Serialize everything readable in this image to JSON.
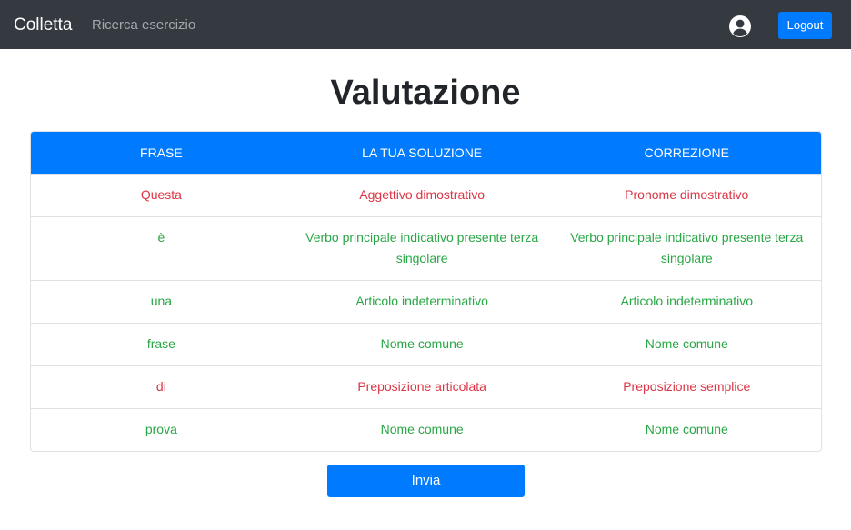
{
  "navbar": {
    "brand": "Colletta",
    "link": "Ricerca esercizio",
    "user_icon": "user-circle-icon",
    "logout_label": "Logout"
  },
  "page": {
    "title": "Valutazione"
  },
  "table": {
    "headers": [
      "FRASE",
      "LA TUA SOLUZIONE",
      "CORREZIONE"
    ],
    "rows": [
      {
        "word": "Questa",
        "solution": "Aggettivo dimostrativo",
        "correction": "Pronome dimostrativo",
        "status": "wrong"
      },
      {
        "word": "è",
        "solution": "Verbo principale indicativo presente terza singolare",
        "correction": "Verbo principale indicativo presente terza singolare",
        "status": "correct"
      },
      {
        "word": "una",
        "solution": "Articolo indeterminativo",
        "correction": "Articolo indeterminativo",
        "status": "correct"
      },
      {
        "word": "frase",
        "solution": "Nome comune",
        "correction": "Nome comune",
        "status": "correct"
      },
      {
        "word": "di",
        "solution": "Preposizione articolata",
        "correction": "Preposizione semplice",
        "status": "wrong"
      },
      {
        "word": "prova",
        "solution": "Nome comune",
        "correction": "Nome comune",
        "status": "correct"
      }
    ]
  },
  "submit": {
    "label": "Invia"
  },
  "colors": {
    "navbar_bg": "#343a40",
    "primary": "#007bff",
    "correct": "#28a745",
    "wrong": "#dc3545"
  }
}
